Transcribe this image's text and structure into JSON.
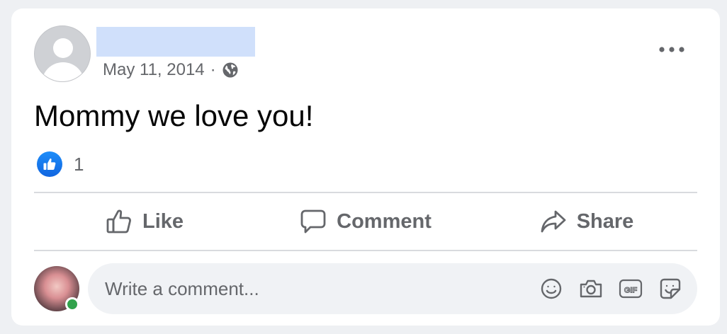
{
  "post": {
    "date": "May 11, 2014",
    "separator": "·",
    "text": "Mommy we love you!",
    "reaction_count": "1"
  },
  "actions": {
    "like_label": "Like",
    "comment_label": "Comment",
    "share_label": "Share"
  },
  "comment": {
    "placeholder": "Write a comment..."
  },
  "icons": {
    "privacy": "globe-icon",
    "menu": "more-options-icon",
    "reaction": "like-reaction-icon",
    "tools": [
      "emoji-icon",
      "camera-icon",
      "gif-icon",
      "sticker-icon"
    ]
  },
  "colors": {
    "accent": "#1877f2",
    "name_placeholder": "#d0e0fb",
    "secondary_text": "#65676b",
    "online": "#31a24c"
  }
}
